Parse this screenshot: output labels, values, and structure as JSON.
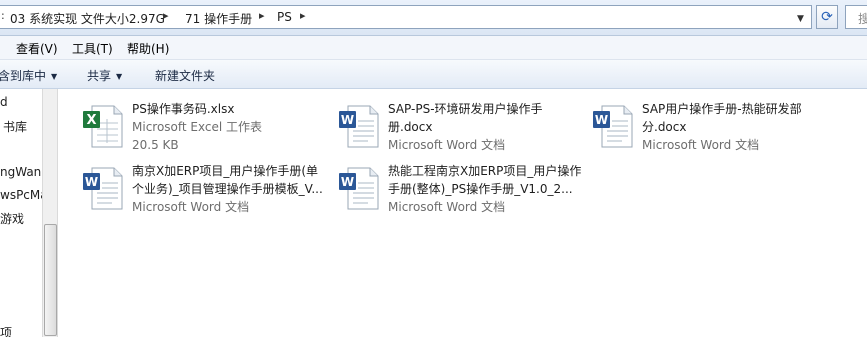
{
  "address_bar": {
    "crumbs": [
      "03 系统实现 文件大小2.97G",
      "71 操作手册",
      "PS"
    ],
    "search_placeholder": "搜"
  },
  "menu": {
    "items": [
      "查看(V)",
      "工具(T)",
      "帮助(H)"
    ]
  },
  "toolbar": {
    "include_library": "含到库中",
    "share": "共享",
    "new_folder": "新建文件夹"
  },
  "nav": {
    "items": [
      "d",
      "书库",
      "ngWan",
      "wsPcMa",
      "游戏",
      "项"
    ]
  },
  "files": [
    {
      "name": "PS操作事务码.xlsx",
      "type": "Microsoft Excel 工作表",
      "size": "20.5 KB",
      "icon": "excel-icon"
    },
    {
      "name": "SAP-PS-环境研发用户操作手册.docx",
      "type": "Microsoft Word 文档",
      "icon": "word-icon"
    },
    {
      "name": "SAP用户操作手册-热能研发部分.docx",
      "type": "Microsoft Word 文档",
      "icon": "word-icon"
    },
    {
      "name": "南京X加ERP项目_用户操作手册(单个业务)_项目管理操作手册模板_V...",
      "type": "Microsoft Word 文档",
      "icon": "word-icon"
    },
    {
      "name": "热能工程南京X加ERP项目_用户操作手册(整体)_PS操作手册_V1.0_2...",
      "type": "Microsoft Word 文档",
      "icon": "word-icon"
    }
  ],
  "colors": {
    "excel_green": "#1f7a3c",
    "word_blue": "#2b5797"
  }
}
